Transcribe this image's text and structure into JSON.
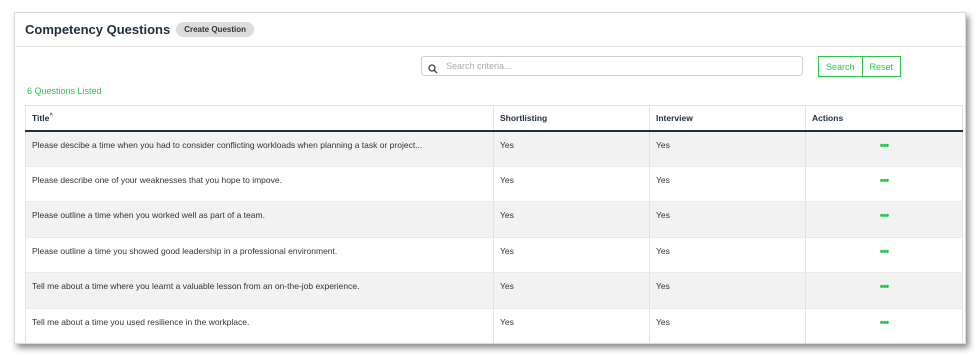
{
  "header": {
    "title": "Competency Questions",
    "create_label": "Create Question"
  },
  "search": {
    "placeholder": "Search criteria...",
    "value": "",
    "search_label": "Search",
    "reset_label": "Reset",
    "icon": "search-icon"
  },
  "count_text": "6 Questions Listed",
  "table": {
    "columns": [
      "Title",
      "Shortlisting",
      "Interview",
      "Actions"
    ],
    "sort_indicator": "^",
    "rows": [
      {
        "title": "Please descibe a time when you had to consider conflicting workloads when planning a task or project...",
        "shortlisting": "Yes",
        "interview": "Yes",
        "actions": "•••"
      },
      {
        "title": "Please describe one of your weaknesses that you hope to impove.",
        "shortlisting": "Yes",
        "interview": "Yes",
        "actions": "•••"
      },
      {
        "title": "Please outline a time when you worked well as part of a team.",
        "shortlisting": "Yes",
        "interview": "Yes",
        "actions": "•••"
      },
      {
        "title": "Please outline a time you showed good leadership in a professional environment.",
        "shortlisting": "Yes",
        "interview": "Yes",
        "actions": "•••"
      },
      {
        "title": "Tell me about a time where you learnt a valuable lesson from an on-the-job experience.",
        "shortlisting": "Yes",
        "interview": "Yes",
        "actions": "•••"
      },
      {
        "title": "Tell me about a time you used resilience in the workplace.",
        "shortlisting": "Yes",
        "interview": "Yes",
        "actions": "•••"
      }
    ]
  },
  "colors": {
    "accent": "#2ec44a",
    "header_text": "#1f2d3d",
    "row_alt": "#f2f2f2"
  }
}
